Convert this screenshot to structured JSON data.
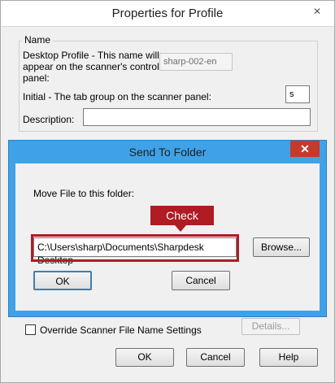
{
  "outer": {
    "title": "Properties for Profile",
    "close_glyph": "✕",
    "group_label": "Name",
    "desktop_profile_label": "Desktop Profile - This name will appear on the scanner's control panel:",
    "desktop_profile_value": "sharp-002-en",
    "initial_label": "Initial - The tab group on the scanner panel:",
    "initial_value": "s",
    "description_label": "Description:",
    "description_value": "",
    "override_label": "Override Scanner File Name Settings",
    "details_button": "Details...",
    "ok_button": "OK",
    "cancel_button": "Cancel",
    "help_button": "Help"
  },
  "inner": {
    "title": "Send To Folder",
    "close_glyph": "✕",
    "folder_label": "Move File to this folder:",
    "folder_value": "C:\\Users\\sharp\\Documents\\Sharpdesk Desktop",
    "browse_button": "Browse...",
    "ok_button": "OK",
    "cancel_button": "Cancel"
  },
  "annotation": {
    "callout_text": "Check",
    "color": "#b01b24"
  },
  "colors": {
    "dialog_frame": "#3fa2e8",
    "close_red": "#c7392b"
  }
}
